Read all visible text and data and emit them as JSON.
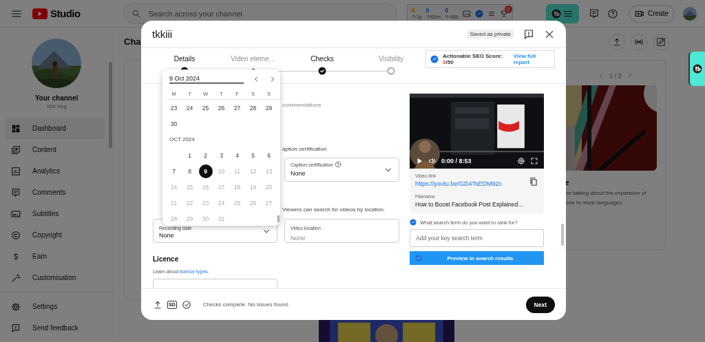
{
  "topbar": {
    "logo_text": "Studio",
    "search_placeholder": "Search across your channel",
    "stats": [
      {
        "value": "0",
        "unit": "1y"
      },
      {
        "value": "0",
        "unit": "60m"
      },
      {
        "value": "0",
        "unit": "48h"
      }
    ],
    "badge": "2",
    "create_label": "Create"
  },
  "sidebar": {
    "channel_title": "Your channel",
    "channel_name": "Visit Vlog",
    "items": [
      {
        "label": "Dashboard",
        "selected": true
      },
      {
        "label": "Content",
        "selected": false
      },
      {
        "label": "Analytics",
        "selected": false
      },
      {
        "label": "Comments",
        "selected": false
      },
      {
        "label": "Subtitles",
        "selected": false
      },
      {
        "label": "Copyright",
        "selected": false
      },
      {
        "label": "Earn",
        "selected": false
      },
      {
        "label": "Customisation",
        "selected": false
      }
    ],
    "footer_items": [
      {
        "label": "Settings"
      },
      {
        "label": "Send feedback"
      }
    ]
  },
  "main": {
    "title": "Cha",
    "card": {
      "pager": "1 / 3",
      "heading": "e",
      "lines": [
        "’re talking about the expansion of",
        "ture to more languages."
      ]
    }
  },
  "modal": {
    "title": "tkkiii",
    "save_status": "Saved as private",
    "steps": [
      {
        "label": "Details",
        "kind": "dot",
        "done": true
      },
      {
        "label": "Video eleme…",
        "kind": "dot",
        "done": false
      },
      {
        "label": "Checks",
        "kind": "check",
        "done": true
      },
      {
        "label": "Visibility",
        "kind": "ring",
        "done": false
      }
    ],
    "seo": {
      "label": "Actionable SEO Score:",
      "score": "0",
      "total": "/50",
      "link": "View full report"
    },
    "form": {
      "recommendations_text": "commendations",
      "caption_heading": "aption certification",
      "caption_field": {
        "label": "Caption certification",
        "value": "None"
      },
      "location_note": "Viewers can search for videos by location.",
      "recording_field": {
        "label": "Recording date",
        "value": "None"
      },
      "location_field": {
        "label": "Video location",
        "placeholder": "None"
      },
      "licence_heading": "Licence",
      "licence_text": "Learn about ",
      "licence_link": "licence types."
    },
    "calendar": {
      "input_value": "9 Oct 2024",
      "weekdays": [
        "M",
        "T",
        "W",
        "T",
        "F",
        "S",
        "S"
      ],
      "blocks": [
        {
          "kind": "weeks",
          "days": [
            {
              "label": "23",
              "disabled": false,
              "selected": false
            },
            {
              "label": "24",
              "disabled": false,
              "selected": false
            },
            {
              "label": "25",
              "disabled": false,
              "selected": false
            },
            {
              "label": "26",
              "disabled": false,
              "selected": false
            },
            {
              "label": "27",
              "disabled": false,
              "selected": false
            },
            {
              "label": "28",
              "disabled": false,
              "selected": false
            },
            {
              "label": "29",
              "disabled": false,
              "selected": false
            },
            {
              "label": "30",
              "disabled": false,
              "selected": false
            }
          ]
        },
        {
          "kind": "heading",
          "label": "OCT 2024"
        },
        {
          "kind": "weeks",
          "days": [
            {
              "label": "1",
              "disabled": false,
              "selected": false
            },
            {
              "label": "2",
              "disabled": false,
              "selected": false
            },
            {
              "label": "3",
              "disabled": false,
              "selected": false
            },
            {
              "label": "4",
              "disabled": false,
              "selected": false
            },
            {
              "label": "5",
              "disabled": false,
              "selected": false
            },
            {
              "label": "6",
              "disabled": false,
              "selected": false
            },
            {
              "label": "7",
              "disabled": false,
              "selected": false
            },
            {
              "label": "8",
              "disabled": false,
              "selected": false
            },
            {
              "label": "9",
              "disabled": false,
              "selected": true
            },
            {
              "label": "10",
              "disabled": true,
              "selected": false
            },
            {
              "label": "11",
              "disabled": true,
              "selected": false
            },
            {
              "label": "12",
              "disabled": true,
              "selected": false
            },
            {
              "label": "13",
              "disabled": true,
              "selected": false
            },
            {
              "label": "14",
              "disabled": true,
              "selected": false
            },
            {
              "label": "15",
              "disabled": true,
              "selected": false
            },
            {
              "label": "16",
              "disabled": true,
              "selected": false
            },
            {
              "label": "17",
              "disabled": true,
              "selected": false
            },
            {
              "label": "18",
              "disabled": true,
              "selected": false
            },
            {
              "label": "19",
              "disabled": true,
              "selected": false
            },
            {
              "label": "20",
              "disabled": true,
              "selected": false
            },
            {
              "label": "21",
              "disabled": true,
              "selected": false
            },
            {
              "label": "22",
              "disabled": true,
              "selected": false
            },
            {
              "label": "23",
              "disabled": true,
              "selected": false
            },
            {
              "label": "24",
              "disabled": true,
              "selected": false
            },
            {
              "label": "25",
              "disabled": true,
              "selected": false
            },
            {
              "label": "26",
              "disabled": true,
              "selected": false
            },
            {
              "label": "27",
              "disabled": true,
              "selected": false
            },
            {
              "label": "28",
              "disabled": true,
              "selected": false
            },
            {
              "label": "29",
              "disabled": true,
              "selected": false
            },
            {
              "label": "30",
              "disabled": true,
              "selected": false
            },
            {
              "label": "31",
              "disabled": true,
              "selected": false
            }
          ]
        }
      ]
    },
    "video": {
      "time": "0:00 / 8:53",
      "link_label": "Video link",
      "link": "https://youtu.be/GD4TsEDM92c",
      "filename_label": "Filename",
      "filename": "How to Boost Facebook Post Explained…"
    },
    "keyword": {
      "question": "What search term do you want to rank for?",
      "placeholder": "Add your key search term",
      "button": "Preview in search results"
    },
    "footer": {
      "quality": "SD",
      "status": "Checks complete. No issues found.",
      "next": "Next"
    }
  }
}
